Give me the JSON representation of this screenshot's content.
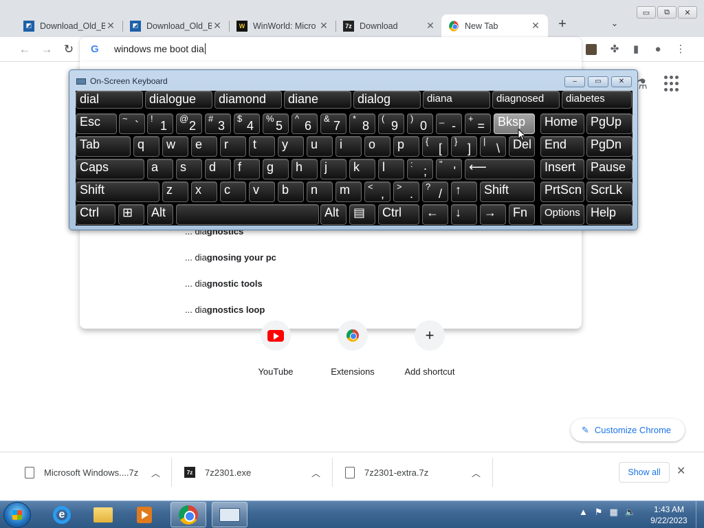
{
  "window": {
    "minimize": "▭",
    "restore": "⧉",
    "close": "✕"
  },
  "tabs": [
    {
      "title": "Download_Old_B",
      "icon": "windows-logo-icon"
    },
    {
      "title": "Download_Old_B",
      "icon": "windows-logo-icon"
    },
    {
      "title": "WinWorld: Micro",
      "icon": "winworld-icon"
    },
    {
      "title": "Download",
      "icon": "7zip-icon"
    },
    {
      "title": "New Tab",
      "icon": "chrome-icon",
      "active": true
    }
  ],
  "omnibox": {
    "text": "windows me boot dia"
  },
  "suggestions": [
    {
      "prefix": "... dia",
      "rest": "gnostics"
    },
    {
      "prefix": "... dia",
      "rest": "gnosing your pc"
    },
    {
      "prefix": "... dia",
      "rest": "gnostic tools"
    },
    {
      "prefix": "... dia",
      "rest": "gnostics loop"
    }
  ],
  "shortcuts": [
    {
      "label": "YouTube"
    },
    {
      "label": "Extensions"
    },
    {
      "label": "Add shortcut"
    }
  ],
  "customize": {
    "label": "Customize Chrome"
  },
  "downloads": [
    {
      "name": "Microsoft Windows....7z"
    },
    {
      "name": "7z2301.exe"
    },
    {
      "name": "7z2301-extra.7z"
    }
  ],
  "shelf": {
    "show_all": "Show all"
  },
  "osk": {
    "title": "On-Screen Keyboard",
    "predictions": [
      "dial",
      "dialogue",
      "diamond",
      "diane",
      "dialog",
      "diana",
      "diagnosed",
      "diabetes"
    ],
    "row1": [
      {
        "main": "Esc"
      },
      {
        "shift": "~",
        "base": "`"
      },
      {
        "shift": "!",
        "base": "1"
      },
      {
        "shift": "@",
        "base": "2"
      },
      {
        "shift": "#",
        "base": "3"
      },
      {
        "shift": "$",
        "base": "4"
      },
      {
        "shift": "%",
        "base": "5"
      },
      {
        "shift": "^",
        "base": "6"
      },
      {
        "shift": "&",
        "base": "7"
      },
      {
        "shift": "*",
        "base": "8"
      },
      {
        "shift": "(",
        "base": "9"
      },
      {
        "shift": ")",
        "base": "0"
      },
      {
        "shift": "_",
        "base": "-"
      },
      {
        "shift": "+",
        "base": "="
      },
      {
        "main": "Bksp"
      },
      {
        "main": "Home"
      },
      {
        "main": "PgUp"
      }
    ],
    "row2": [
      {
        "main": "Tab"
      },
      {
        "main": "q"
      },
      {
        "main": "w"
      },
      {
        "main": "e"
      },
      {
        "main": "r"
      },
      {
        "main": "t"
      },
      {
        "main": "y"
      },
      {
        "main": "u"
      },
      {
        "main": "i"
      },
      {
        "main": "o"
      },
      {
        "main": "p"
      },
      {
        "shift": "{",
        "base": "["
      },
      {
        "shift": "}",
        "base": "]"
      },
      {
        "shift": "|",
        "base": "\\"
      },
      {
        "main": "Del"
      },
      {
        "main": "End"
      },
      {
        "main": "PgDn"
      }
    ],
    "row3": [
      {
        "main": "Caps"
      },
      {
        "main": "a"
      },
      {
        "main": "s"
      },
      {
        "main": "d"
      },
      {
        "main": "f"
      },
      {
        "main": "g"
      },
      {
        "main": "h"
      },
      {
        "main": "j"
      },
      {
        "main": "k"
      },
      {
        "main": "l"
      },
      {
        "shift": ":",
        "base": ";"
      },
      {
        "shift": "\"",
        "base": "'"
      },
      {
        "main": "⟵"
      },
      {
        "main": "Insert"
      },
      {
        "main": "Pause"
      }
    ],
    "row4": [
      {
        "main": "Shift"
      },
      {
        "main": "z"
      },
      {
        "main": "x"
      },
      {
        "main": "c"
      },
      {
        "main": "v"
      },
      {
        "main": "b"
      },
      {
        "main": "n"
      },
      {
        "main": "m"
      },
      {
        "shift": "<",
        "base": ","
      },
      {
        "shift": ">",
        "base": "."
      },
      {
        "shift": "?",
        "base": "/"
      },
      {
        "main": "↑"
      },
      {
        "main": "Shift"
      },
      {
        "main": "PrtScn"
      },
      {
        "main": "ScrLk"
      }
    ],
    "row5": [
      {
        "main": "Ctrl"
      },
      {
        "main": "⊞"
      },
      {
        "main": "Alt"
      },
      {
        "main": ""
      },
      {
        "main": "Alt"
      },
      {
        "main": "▤"
      },
      {
        "main": "Ctrl"
      },
      {
        "main": "←"
      },
      {
        "main": "↓"
      },
      {
        "main": "→"
      },
      {
        "main": "Fn"
      },
      {
        "main": "Options"
      },
      {
        "main": "Help"
      }
    ]
  },
  "taskbar": {
    "apps": [
      "internet-explorer",
      "file-explorer",
      "media-player",
      "google-chrome",
      "on-screen-keyboard"
    ],
    "tray_arrow": "▲",
    "time": "1:43 AM",
    "date": "9/22/2023"
  }
}
